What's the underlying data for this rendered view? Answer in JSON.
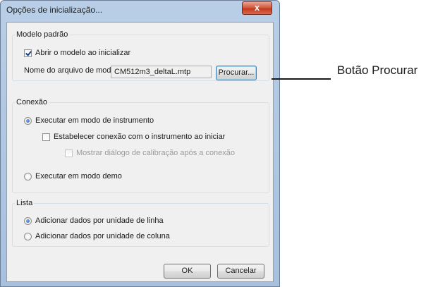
{
  "window": {
    "title": "Opções de inicialização...",
    "close_label": "x"
  },
  "model_group": {
    "title": "Modelo padrão",
    "open_on_start": {
      "label": "Abrir o modelo ao inicializar",
      "checked": true
    },
    "filename_label": "Nome do arquivo de modelo:",
    "filename_value": "CM512m3_deltaL.mtp",
    "browse_label": "Procurar..."
  },
  "connection_group": {
    "title": "Conexão",
    "instrument_mode": {
      "label": "Executar em modo de instrumento",
      "selected": true
    },
    "connect_on_start": {
      "label": "Estabelecer conexão com o instrumento ao iniciar",
      "checked": false
    },
    "show_calibration": {
      "label": "Mostrar diálogo de calibração após a conexão",
      "checked": false,
      "enabled": false
    },
    "demo_mode": {
      "label": "Executar em modo demo",
      "selected": false
    }
  },
  "list_group": {
    "title": "Lista",
    "by_row": {
      "label": "Adicionar dados por unidade de linha",
      "selected": true
    },
    "by_column": {
      "label": "Adicionar dados por unidade de coluna",
      "selected": false
    }
  },
  "buttons": {
    "ok": "OK",
    "cancel": "Cancelar"
  },
  "annotation": {
    "text": "Botão Procurar"
  },
  "colors": {
    "window_frame": "#a7c0dd",
    "close_button": "#c43b1e",
    "client_bg": "#f0f0f0",
    "focus_border": "#3c7fb1"
  }
}
